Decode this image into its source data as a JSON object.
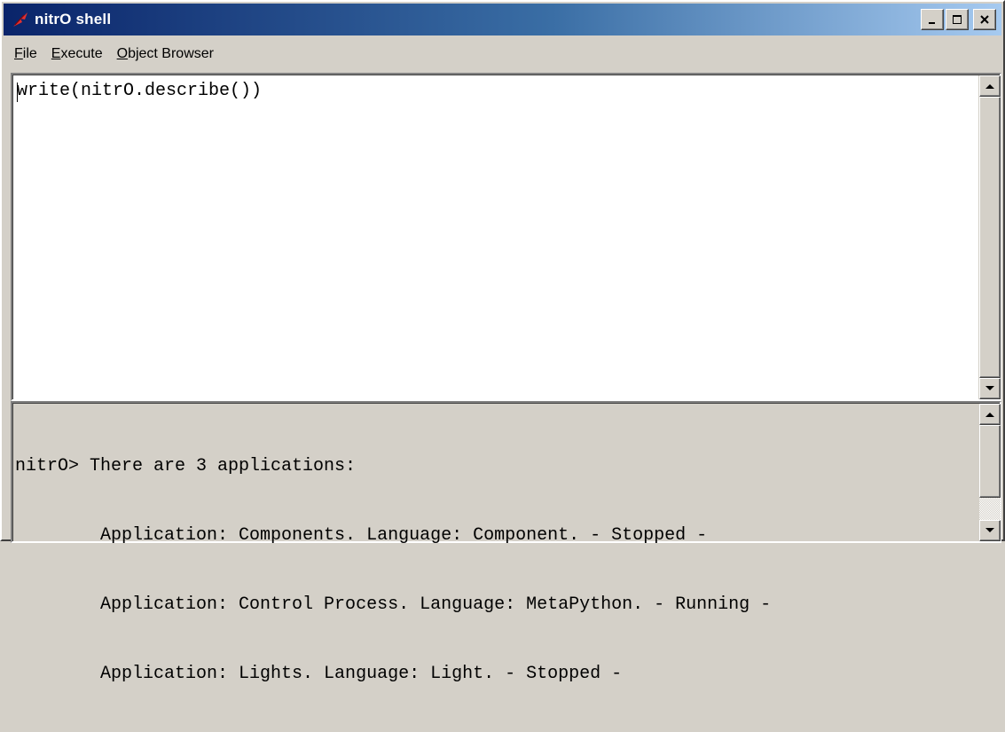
{
  "window": {
    "title": "nitrO shell",
    "icon": "tk-feather-icon",
    "buttons": [
      "minimize",
      "maximize",
      "close"
    ]
  },
  "menu": {
    "items": [
      {
        "label_u": "F",
        "label_rest": "ile"
      },
      {
        "label_u": "E",
        "label_rest": "xecute"
      },
      {
        "label_u": "O",
        "label_rest": "bject Browser"
      }
    ]
  },
  "editor": {
    "code": "write(nitrO.describe())"
  },
  "output": {
    "lines": [
      "nitrO> There are 3 applications:",
      "        Application: Components. Language: Component. - Stopped -",
      "        Application: Control Process. Language: MetaPython. - Running -",
      "        Application: Lights. Language: Light. - Stopped -"
    ]
  },
  "colors": {
    "face": "#d4d0c8",
    "title_start": "#0a246a",
    "title_end": "#a6caf0"
  }
}
